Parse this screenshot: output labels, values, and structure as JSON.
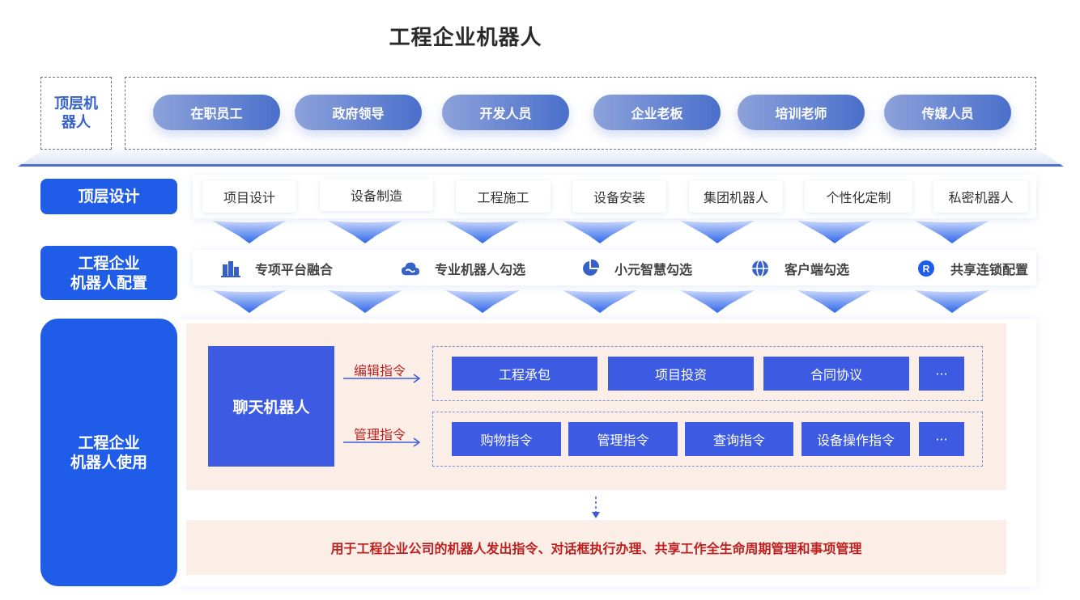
{
  "title": "工程企业机器人",
  "top_layer": {
    "label": "顶层机\n器人",
    "roles": [
      "在职员工",
      "政府领导",
      "开发人员",
      "企业老板",
      "培训老师",
      "传媒人员"
    ]
  },
  "design": {
    "label": "顶层设计",
    "items": [
      "项目设计",
      "设备制造",
      "工程施工",
      "设备安装",
      "集团机器人",
      "个性化定制",
      "私密机器人"
    ]
  },
  "config": {
    "label": "工程企业\n机器人配置",
    "items": [
      {
        "icon": "building-chart-icon",
        "text": "专项平台融合"
      },
      {
        "icon": "cloud-icon",
        "text": "专业机器人勾选"
      },
      {
        "icon": "pie-chart-icon",
        "text": "小元智慧勾选"
      },
      {
        "icon": "globe-icon",
        "text": "客户端勾选"
      },
      {
        "icon": "registered-icon",
        "text": "共享连锁配置"
      }
    ]
  },
  "usage": {
    "label": "工程企业\n机器人使用",
    "chat_bot": "聊天机器人",
    "edit_cmd_label": "编辑指令",
    "manage_cmd_label": "管理指令",
    "edit_cmds": [
      "工程承包",
      "项目投资",
      "合同协议",
      "···"
    ],
    "manage_cmds": [
      "购物指令",
      "管理指令",
      "查询指令",
      "设备操作指令",
      "···"
    ],
    "summary": "用于工程企业公司的机器人发出指令、对话框执行办理、共享工作全生命周期管理和事项管理"
  },
  "colors": {
    "primary_blue": "#1f5de8",
    "command_blue": "#3d5be2",
    "accent_red": "#c01f1f",
    "panel_peach": "#fbeee6"
  }
}
